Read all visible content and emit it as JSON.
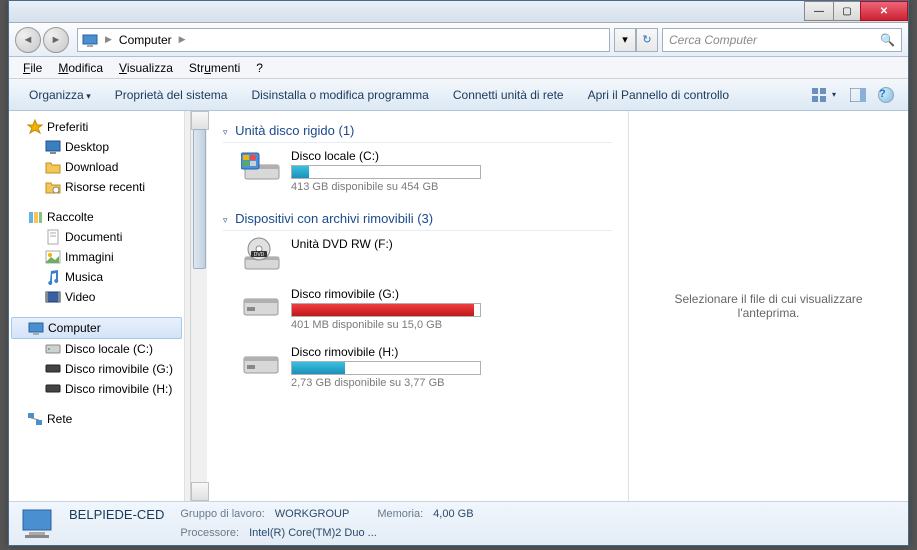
{
  "titlebar": {},
  "nav": {
    "path_segments": [
      "Computer"
    ],
    "search_placeholder": "Cerca Computer"
  },
  "menu": {
    "file": "File",
    "modifica": "Modifica",
    "visualizza": "Visualizza",
    "strumenti": "Strumenti",
    "help": "?"
  },
  "cmdbar": {
    "organizza": "Organizza",
    "proprieta": "Proprietà del sistema",
    "disinstalla": "Disinstalla o modifica programma",
    "connetti": "Connetti unità di rete",
    "apri": "Apri il Pannello di controllo"
  },
  "sidebar": {
    "preferiti": {
      "label": "Preferiti",
      "items": [
        {
          "label": "Desktop"
        },
        {
          "label": "Download"
        },
        {
          "label": "Risorse recenti"
        }
      ]
    },
    "raccolte": {
      "label": "Raccolte",
      "items": [
        {
          "label": "Documenti"
        },
        {
          "label": "Immagini"
        },
        {
          "label": "Musica"
        },
        {
          "label": "Video"
        }
      ]
    },
    "computer": {
      "label": "Computer",
      "items": [
        {
          "label": "Disco locale (C:)"
        },
        {
          "label": "Disco rimovibile (G:)"
        },
        {
          "label": "Disco rimovibile (H:)"
        }
      ]
    },
    "rete": {
      "label": "Rete"
    }
  },
  "content": {
    "groups": [
      {
        "title": "Unità disco rigido",
        "count": "(1)",
        "drives": [
          {
            "name": "Disco locale (C:)",
            "status": "413 GB disponibile su 454 GB",
            "fill_pct": 9,
            "fill_color": "blue",
            "has_bar": true,
            "icon": "hdd"
          }
        ]
      },
      {
        "title": "Dispositivi con archivi rimovibili",
        "count": "(3)",
        "drives": [
          {
            "name": "Unità DVD RW (F:)",
            "status": "",
            "has_bar": false,
            "icon": "dvd"
          },
          {
            "name": "Disco rimovibile (G:)",
            "status": "401 MB disponibile su 15,0 GB",
            "fill_pct": 97,
            "fill_color": "red",
            "has_bar": true,
            "icon": "removable"
          },
          {
            "name": "Disco rimovibile (H:)",
            "status": "2,73 GB disponibile su 3,77 GB",
            "fill_pct": 28,
            "fill_color": "blue",
            "has_bar": true,
            "icon": "removable"
          }
        ]
      }
    ]
  },
  "preview": {
    "placeholder": "Selezionare il file di cui visualizzare l'anteprima."
  },
  "details": {
    "name": "BELPIEDE-CED",
    "gruppo_label": "Gruppo di lavoro:",
    "gruppo_value": "WORKGROUP",
    "memoria_label": "Memoria:",
    "memoria_value": "4,00 GB",
    "processore_label": "Processore:",
    "processore_value": "Intel(R) Core(TM)2 Duo ..."
  },
  "icons": {
    "star": "#f5b301",
    "folder": "#f3c658"
  }
}
